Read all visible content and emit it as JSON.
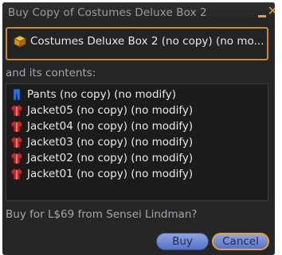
{
  "window": {
    "title": "Buy Copy of Costumes Deluxe Box 2",
    "minimize_icon": "minimize-icon",
    "close_glyph": "✕"
  },
  "item": {
    "icon": "box-icon",
    "name": "Costumes Deluxe Box 2 (no copy) (no mo..."
  },
  "contents": {
    "label": "and its contents:",
    "items": [
      {
        "icon": "pants-icon",
        "label": "Pants (no copy) (no modify)"
      },
      {
        "icon": "jacket-icon",
        "label": "Jacket05 (no copy) (no modify)"
      },
      {
        "icon": "jacket-icon",
        "label": "Jacket04 (no copy) (no modify)"
      },
      {
        "icon": "jacket-icon",
        "label": "Jacket03 (no copy) (no modify)"
      },
      {
        "icon": "jacket-icon",
        "label": "Jacket02 (no copy) (no modify)"
      },
      {
        "icon": "jacket-icon",
        "label": "Jacket01 (no copy) (no modify)"
      }
    ]
  },
  "confirm_text": "Buy for L$69 from Sensei Lindman?",
  "buttons": {
    "buy": "Buy",
    "cancel": "Cancel"
  },
  "colors": {
    "accent": "#e0a040",
    "button_blue": "#6f87d6",
    "jacket_red": "#c0282a",
    "pants_blue": "#2f6fd8"
  }
}
